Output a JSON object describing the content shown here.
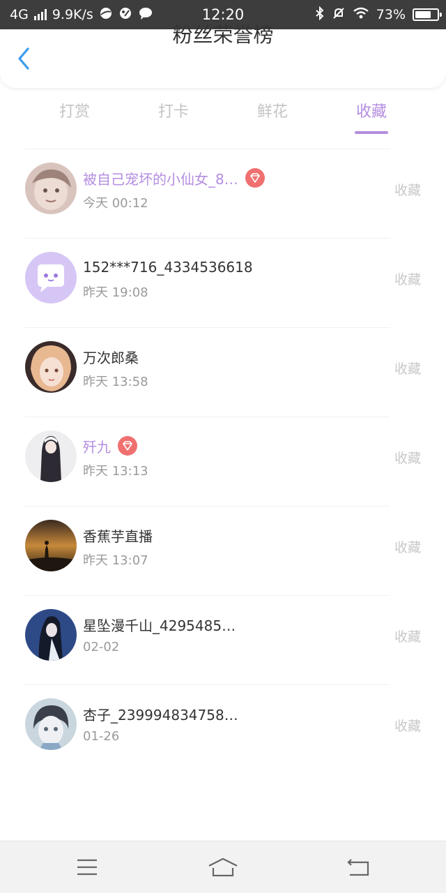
{
  "status_bar": {
    "network": "4G",
    "speed": "9.9K/s",
    "time": "12:20",
    "battery": "73%",
    "battery_level": 0.73,
    "icons": [
      "signal-icon",
      "globe-icon",
      "palette-icon",
      "chat-bubble-icon",
      "bluetooth-icon",
      "bell-off-icon",
      "wifi-icon",
      "battery-icon"
    ]
  },
  "header": {
    "title": "粉丝荣誉榜",
    "back_icon": "chevron-left-icon"
  },
  "tabs": [
    {
      "label": "打赏",
      "active": false
    },
    {
      "label": "打卡",
      "active": false
    },
    {
      "label": "鲜花",
      "active": false
    },
    {
      "label": "收藏",
      "active": true
    }
  ],
  "colors": {
    "accent": "#b48de0",
    "vip_badge": "#f07070",
    "muted_text": "#9a9a9a",
    "action_text": "#c8c8c8"
  },
  "list": [
    {
      "name": "被自己宠坏的小仙女_8…",
      "time": "今天 00:12",
      "action": "收藏",
      "vip": true,
      "avatar": "avatar-girl-sketch"
    },
    {
      "name": "152***716_4334536618",
      "time": "昨天 19:08",
      "action": "收藏",
      "vip": false,
      "avatar": "avatar-default-chat"
    },
    {
      "name": "万次郎桑",
      "time": "昨天 13:58",
      "action": "收藏",
      "vip": false,
      "avatar": "avatar-anime-blonde"
    },
    {
      "name": "歼九",
      "time": "昨天 13:13",
      "action": "收藏",
      "vip": true,
      "avatar": "avatar-anime-nun"
    },
    {
      "name": "香蕉芋直播",
      "time": "昨天 13:07",
      "action": "收藏",
      "vip": false,
      "avatar": "avatar-sunset-silhouette"
    },
    {
      "name": "星坠漫千山_4295485…",
      "time": "02-02",
      "action": "收藏",
      "vip": false,
      "avatar": "avatar-anime-dark-hair"
    },
    {
      "name": "杏子_239994834758…",
      "time": "01-26",
      "action": "收藏",
      "vip": false,
      "avatar": "avatar-anime-girl"
    }
  ],
  "navbar": {
    "icons": [
      "menu-icon",
      "home-icon",
      "back-icon"
    ]
  }
}
